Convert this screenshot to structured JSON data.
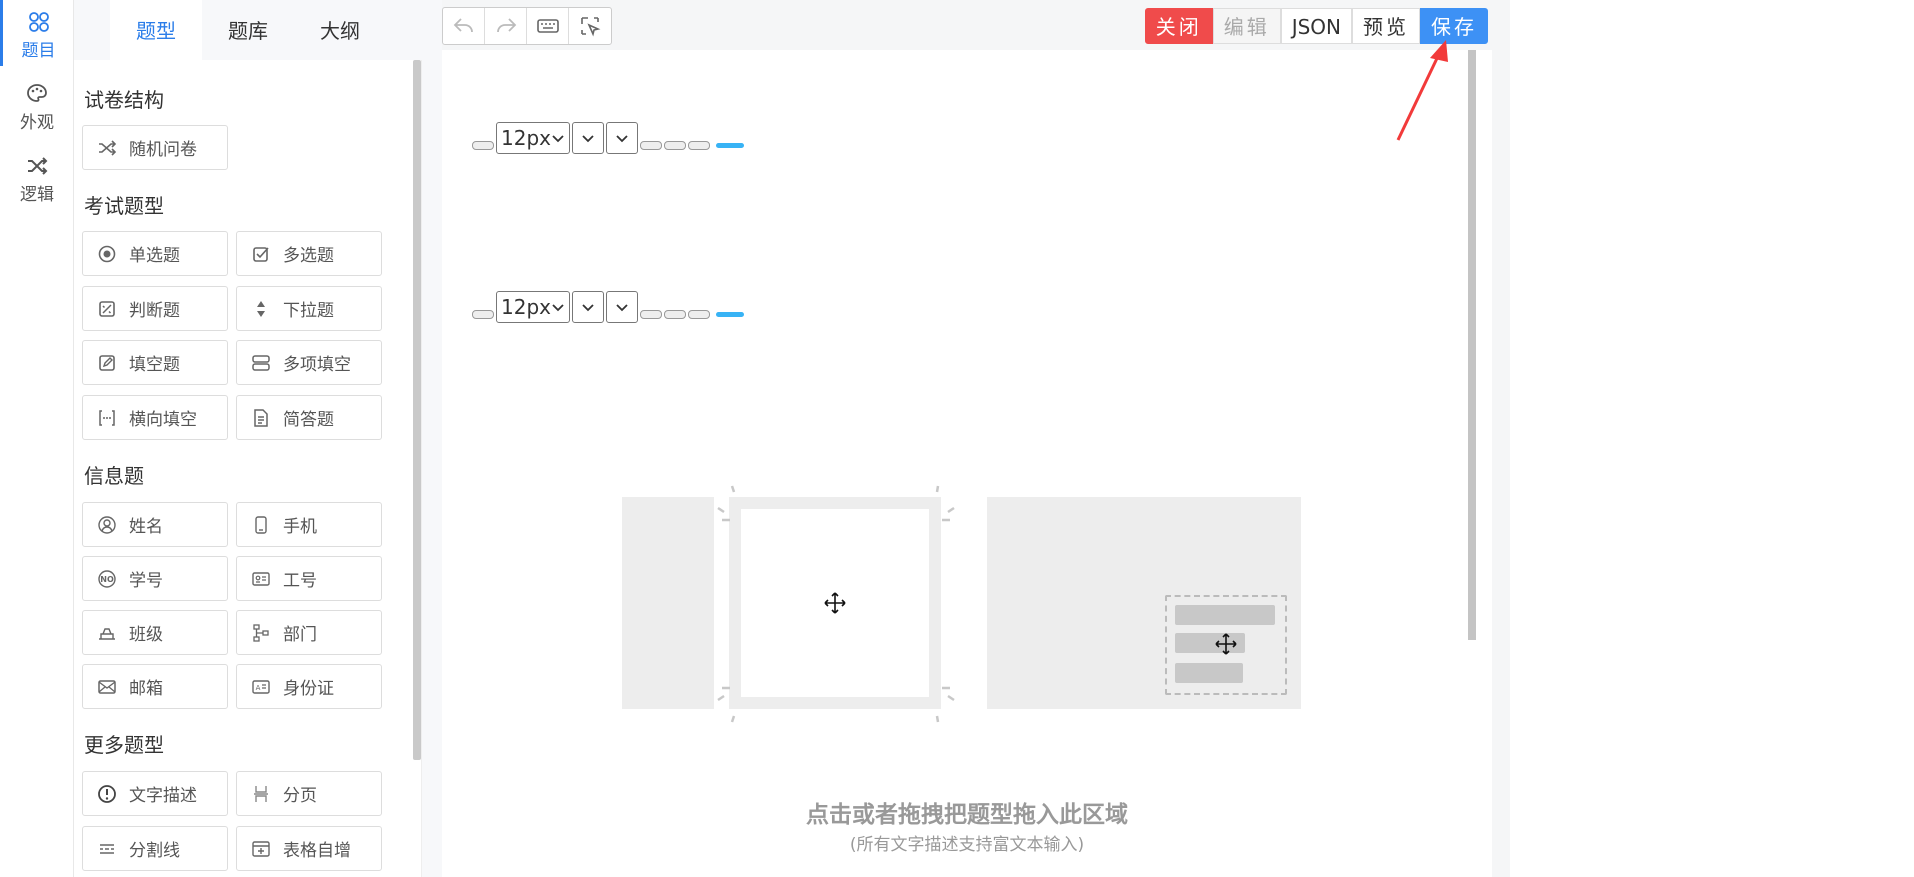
{
  "leftnav": {
    "items": [
      {
        "label": "题目",
        "icon": "circles-icon",
        "active": true
      },
      {
        "label": "外观",
        "icon": "palette-icon",
        "active": false
      },
      {
        "label": "逻辑",
        "icon": "shuffle-icon",
        "active": false
      }
    ]
  },
  "panel": {
    "tabs": [
      {
        "label": "题型",
        "active": true
      },
      {
        "label": "题库",
        "active": false
      },
      {
        "label": "大纲",
        "active": false
      }
    ],
    "sections": {
      "structure": {
        "title": "试卷结构",
        "items": [
          "随机问卷"
        ]
      },
      "exam": {
        "title": "考试题型",
        "items": [
          "单选题",
          "多选题",
          "判断题",
          "下拉题",
          "填空题",
          "多项填空",
          "横向填空",
          "简答题"
        ]
      },
      "info": {
        "title": "信息题",
        "items": [
          "姓名",
          "手机",
          "学号",
          "工号",
          "班级",
          "部门",
          "邮箱",
          "身份证"
        ]
      },
      "more": {
        "title": "更多题型",
        "items": [
          "文字描述",
          "分页",
          "分割线",
          "表格自增"
        ]
      }
    }
  },
  "toolbar": {
    "tools": [
      "undo-icon",
      "redo-icon",
      "keyboard-icon",
      "select-icon"
    ],
    "close_label": "关闭",
    "edit_label": "编辑",
    "json_label": "JSON",
    "preview_label": "预览",
    "save_label": "保存"
  },
  "editor": {
    "font_size_1": "12px",
    "font_size_2": "12px"
  },
  "empty_state": {
    "title": "点击或者拖拽把题型拖入此区域",
    "subtitle": "(所有文字描述支持富文本输入)"
  },
  "colors": {
    "accent": "#2b7de9",
    "close": "#f04b4b",
    "save": "#3d91f5",
    "arrow": "#f23a3a"
  }
}
